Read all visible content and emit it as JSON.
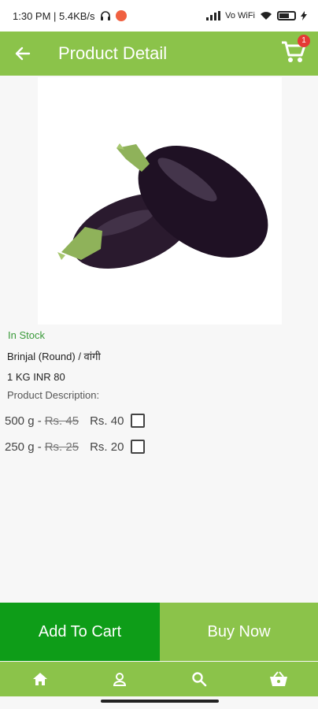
{
  "status_bar": {
    "time_speed": "1:30 PM | 5.4KB/s",
    "network_label": "Vo WiFi",
    "battery_level": 0.5
  },
  "header": {
    "title": "Product Detail",
    "cart_count": "1"
  },
  "product": {
    "image_name": "brinjal-round-image",
    "stock_status": "In Stock",
    "name": "Brinjal (Round) / वांगी",
    "price_line": "1 KG INR 80",
    "description_label": "Product Description:",
    "options": [
      {
        "weight": "500 g -",
        "old_price": "Rs. 45",
        "new_price": "Rs. 40"
      },
      {
        "weight": "250 g -",
        "old_price": "Rs. 25",
        "new_price": "Rs. 20"
      }
    ]
  },
  "actions": {
    "add_to_cart": "Add To Cart",
    "buy_now": "Buy Now"
  },
  "colors": {
    "primary": "#8bc34a",
    "add_to_cart": "#0e9d18",
    "stock": "#3a9a3a",
    "badge": "#e53935"
  }
}
